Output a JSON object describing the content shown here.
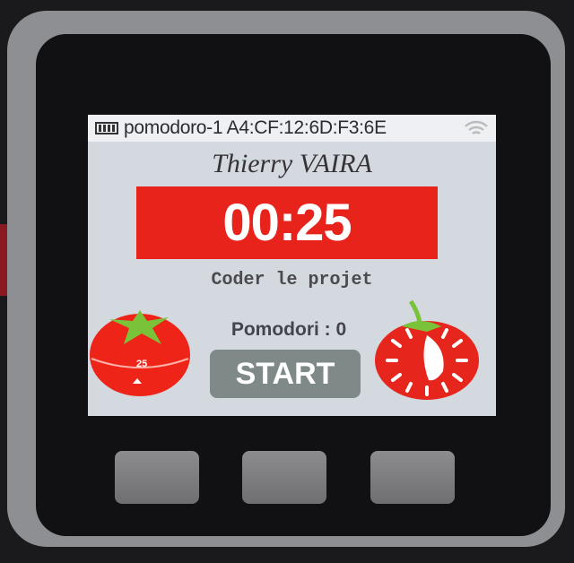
{
  "status_bar": {
    "device_name": "pomodoro-1",
    "mac": "A4:CF:12:6D:F3:6E",
    "battery_icon": "battery-icon",
    "wifi_icon": "wifi-icon"
  },
  "owner": "Thierry VAIRA",
  "timer": {
    "value": "00:25",
    "color": "#e8231b"
  },
  "task": "Coder le projet",
  "pomodori": {
    "label": "Pomodori : 0"
  },
  "start_button": {
    "label": "START"
  },
  "timer_dial_label": "25"
}
